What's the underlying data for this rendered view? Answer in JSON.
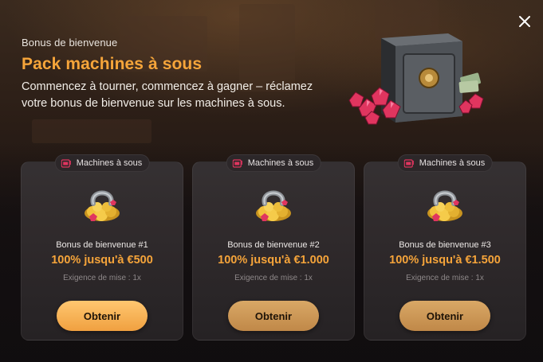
{
  "header": {
    "eyebrow": "Bonus de bienvenue",
    "title": "Pack machines à sous",
    "description": "Commencez à tourner, commencez à gagner – réclamez votre bonus de bienvenue sur les machines à sous."
  },
  "colors": {
    "accent": "#f6a53a",
    "button_primary": "#fdb55a",
    "button_muted": "#cd9856"
  },
  "cards": [
    {
      "tag_label": "Machines à sous",
      "tag_icon": "slot-machine-icon",
      "reward_icon": "horseshoe-gold-icon",
      "title": "Bonus de bienvenue #1",
      "amount": "100% jusqu'à €500",
      "wager": "Exigence de mise : 1x",
      "button_label": "Obtenir"
    },
    {
      "tag_label": "Machines à sous",
      "tag_icon": "slot-machine-icon",
      "reward_icon": "horseshoe-gold-icon",
      "title": "Bonus de bienvenue #2",
      "amount": "100% jusqu'à €1.000",
      "wager": "Exigence de mise : 1x",
      "button_label": "Obtenir"
    },
    {
      "tag_label": "Machines à sous",
      "tag_icon": "slot-machine-icon",
      "reward_icon": "horseshoe-gold-icon",
      "title": "Bonus de bienvenue #3",
      "amount": "100% jusqu'à €1.500",
      "wager": "Exigence de mise : 1x",
      "button_label": "Obtenir"
    }
  ],
  "icons": {
    "close": "close-icon",
    "hero": "vault-safe-gems-icon"
  }
}
